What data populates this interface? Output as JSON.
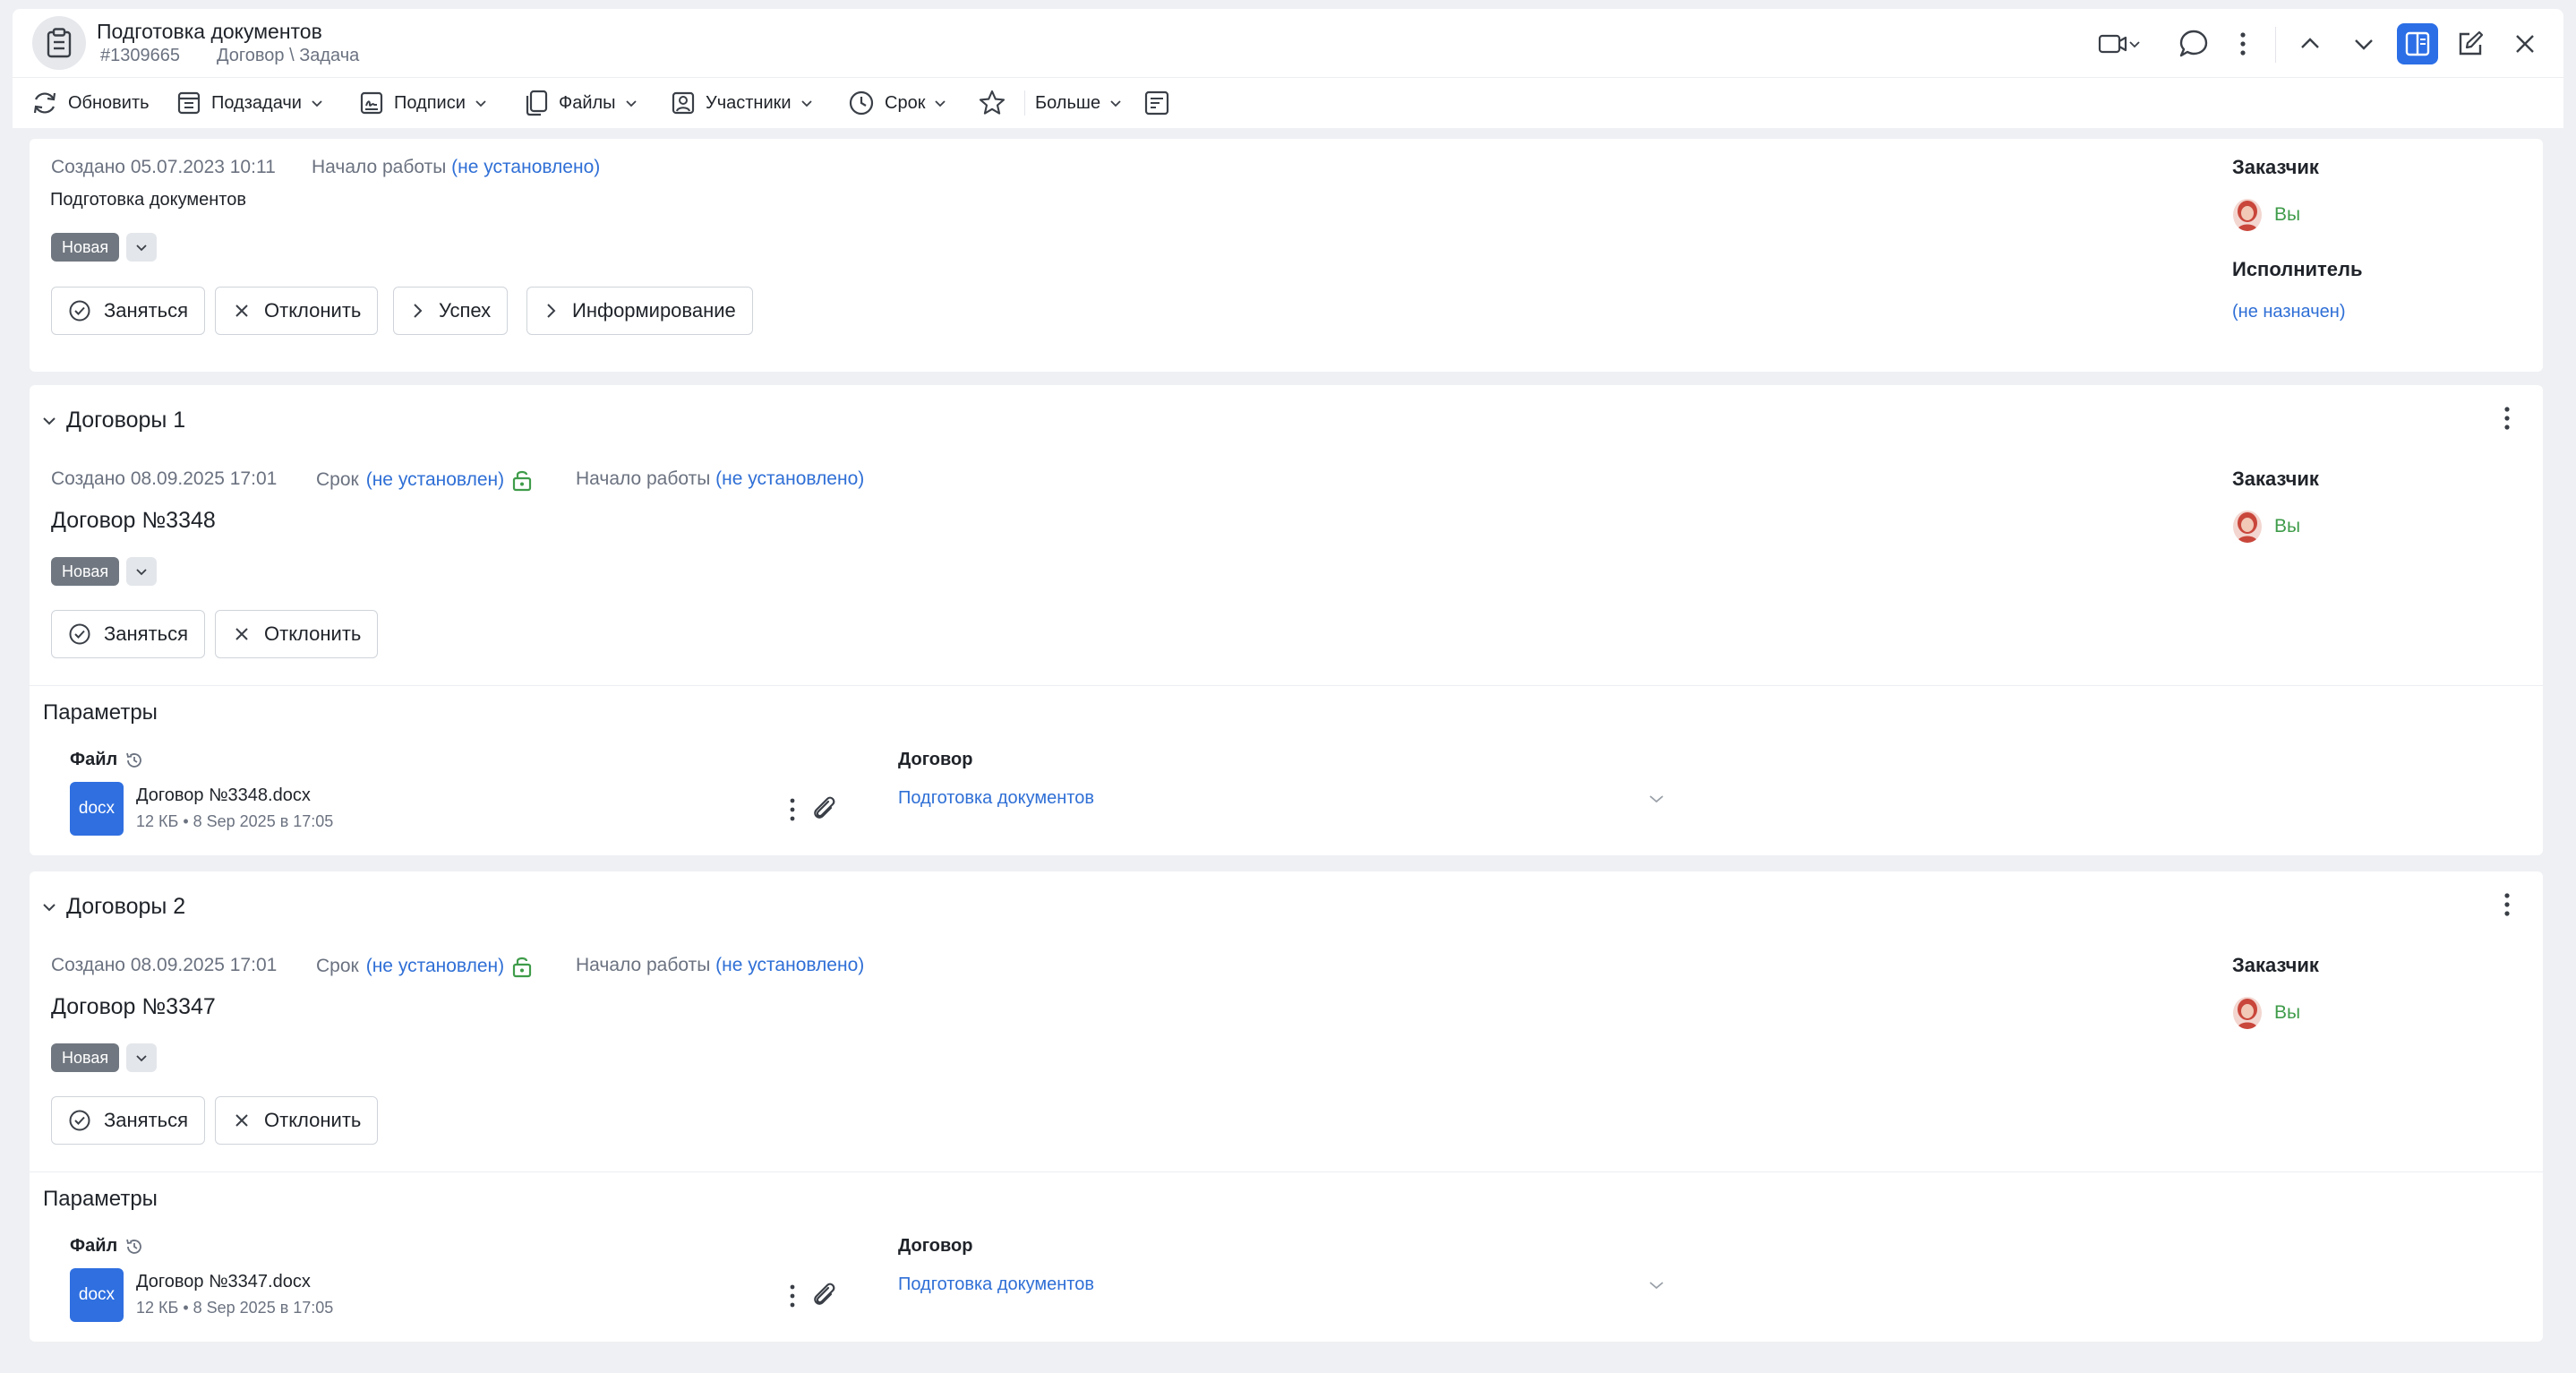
{
  "header": {
    "title": "Подготовка документов",
    "ticket_id": "#1309665",
    "breadcrumb": "Договор \\ Задача"
  },
  "toolbar": {
    "refresh": "Обновить",
    "subtasks": "Подзадачи",
    "signatures": "Подписи",
    "files": "Файлы",
    "participants": "Участники",
    "deadline": "Срок",
    "more": "Больше"
  },
  "main_task": {
    "created": "Создано 05.07.2023 10:11",
    "start_label": "Начало работы",
    "start_value": "(не установлено)",
    "description": "Подготовка документов",
    "status": "Новая",
    "actions": {
      "take": "Заняться",
      "reject": "Отклонить",
      "success": "Успех",
      "inform": "Информирование"
    },
    "customer_label": "Заказчик",
    "customer_value": "Вы",
    "assignee_label": "Исполнитель",
    "assignee_value": "(не назначен)"
  },
  "contracts": [
    {
      "section_title": "Договоры 1",
      "created": "Создано 08.09.2025 17:01",
      "deadline_label": "Срок",
      "deadline_value": "(не установлен)",
      "start_label": "Начало работы",
      "start_value": "(не установлено)",
      "name": "Договор №3348",
      "status": "Новая",
      "take": "Заняться",
      "reject": "Отклонить",
      "customer_label": "Заказчик",
      "customer_value": "Вы",
      "params_title": "Параметры",
      "file_label": "Файл",
      "file_type": "docx",
      "file_name": "Договор №3348.docx",
      "file_meta": "12 КБ • 8 Sep 2025 в 17:05",
      "contract_label": "Договор",
      "contract_value": "Подготовка документов"
    },
    {
      "section_title": "Договоры 2",
      "created": "Создано 08.09.2025 17:01",
      "deadline_label": "Срок",
      "deadline_value": "(не установлен)",
      "start_label": "Начало работы",
      "start_value": "(не установлено)",
      "name": "Договор №3347",
      "status": "Новая",
      "take": "Заняться",
      "reject": "Отклонить",
      "customer_label": "Заказчик",
      "customer_value": "Вы",
      "params_title": "Параметры",
      "file_label": "Файл",
      "file_type": "docx",
      "file_name": "Договор №3347.docx",
      "file_meta": "12 КБ • 8 Sep 2025 в 17:05",
      "contract_label": "Договор",
      "contract_value": "Подготовка документов"
    }
  ],
  "colors": {
    "accent": "#2f6fd6",
    "active_button": "#2b6ee6",
    "status_badge": "#707780",
    "you_green": "#3f9c4a",
    "lock_green": "#3f9c4a"
  },
  "icons": [
    "clipboard-icon",
    "video-icon",
    "chat-icon",
    "kebab-icon",
    "chevron-up-icon",
    "chevron-down-icon",
    "split-view-icon",
    "edit-icon",
    "close-icon",
    "refresh-icon",
    "subtasks-icon",
    "signature-icon",
    "files-icon",
    "participants-icon",
    "clock-icon",
    "star-icon",
    "form-icon",
    "check-circle-icon",
    "x-icon",
    "chevron-right-icon",
    "lock-icon",
    "history-icon",
    "paperclip-icon"
  ]
}
